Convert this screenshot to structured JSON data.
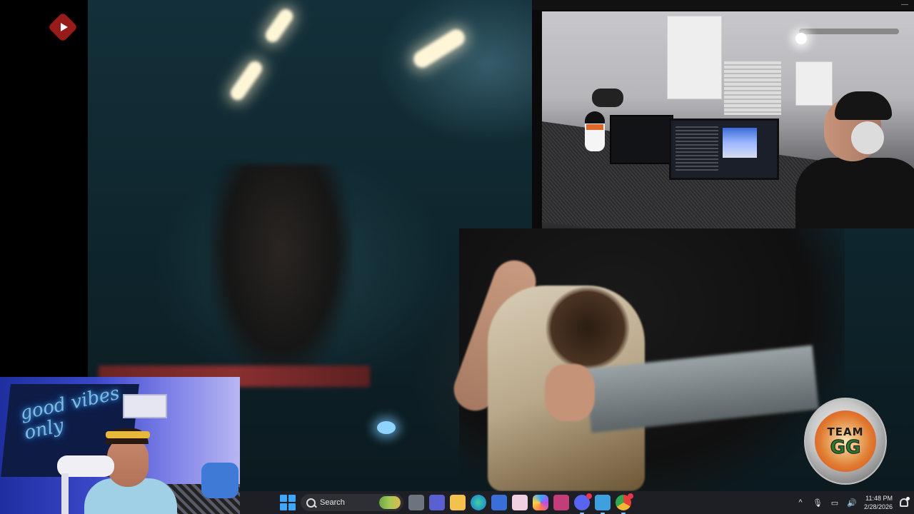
{
  "overlay": {
    "youtube_icon": "youtube-play-icon",
    "badge": {
      "line1": "TEAM",
      "line2": "GG"
    },
    "neon_sign": "good vibes only"
  },
  "taskbar": {
    "search_label": "Search",
    "apps": [
      "start-icon",
      "search-icon",
      "task-view-icon",
      "teams-icon",
      "file-explorer-icon",
      "edge-icon",
      "store-icon",
      "pink-app-icon",
      "copilot-icon",
      "puzzle-app-icon",
      "discord-icon",
      "notepad-icon",
      "chrome-icon"
    ],
    "tray": {
      "chevron": "^",
      "time": "11:48 PM",
      "date": "2/28/2026"
    }
  },
  "colors": {
    "taskbar_bg": "#1d1f24",
    "accent": "#3ea6ff"
  }
}
